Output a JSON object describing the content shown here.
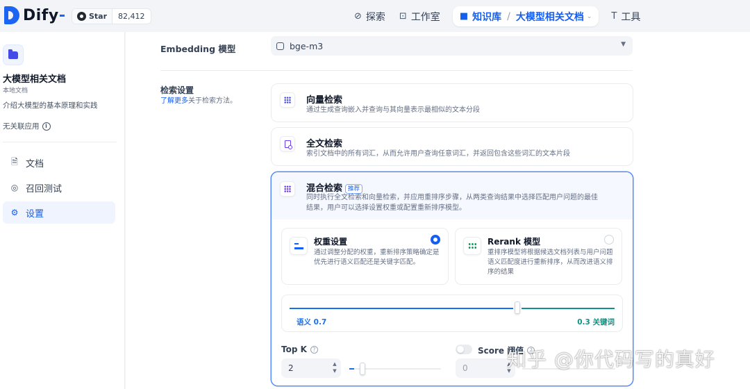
{
  "app": {
    "name": "Dify",
    "github_star_label": "Star",
    "github_star_count": "82,412"
  },
  "nav": {
    "explore": "探索",
    "studio": "工作室",
    "knowledge": "知识库",
    "separator": "/",
    "current_dataset": "大模型相关文档",
    "tools": "工具"
  },
  "sidebar": {
    "dataset_name": "大模型相关文档",
    "dataset_type": "本地文档",
    "dataset_desc": "介绍大模型的基本原理和实践",
    "linked_apps": "无关联应用",
    "items": [
      {
        "label": "文档",
        "icon": "document-icon"
      },
      {
        "label": "召回测试",
        "icon": "target-icon"
      },
      {
        "label": "设置",
        "icon": "gear-icon",
        "active": true
      }
    ]
  },
  "settings": {
    "embedding_label": "Embedding 模型",
    "embedding_value": "bge-m3",
    "retrieval_label": "检索设置",
    "retrieval_help_link": "了解更多",
    "retrieval_help_text": "关于检索方法。",
    "methods": [
      {
        "title": "向量检索",
        "desc": "通过生成查询嵌入并查询与其向量表示最相似的文本分段"
      },
      {
        "title": "全文检索",
        "desc": "索引文档中的所有词汇，从而允许用户查询任意词汇，并返回包含这些词汇的文本片段"
      },
      {
        "title": "混合检索",
        "badge": "推荐",
        "desc_line1": "同时执行全文检索和向量检索，并应用重排序步骤，从两类查询结果中选择匹配用户问题的最佳",
        "desc_line2": "结果，用户可以选择设置权重或配置重新排序模型。",
        "selected": true
      }
    ],
    "hybrid": {
      "weight_title": "权重设置",
      "weight_desc": "通过调整分配的权重，重新排序策略确定是优先进行语义匹配还是关键字匹配。",
      "weight_selected": true,
      "rerank_title": "Rerank 模型",
      "rerank_desc": "重排序模型将根据候选文档列表与用户问题语义匹配度进行重新排序，从而改进语义排序的结果",
      "rerank_selected": false,
      "semantic_label": "语义 0.7",
      "keyword_label": "0.3 关键词",
      "semantic_weight": 0.7
    },
    "top_k_label": "Top K",
    "top_k_value": "2",
    "top_k_fraction": 0.05,
    "score_label": "Score 阈值",
    "score_enabled": false,
    "score_value": "0"
  },
  "watermark": "知乎 @你代码写的真好",
  "colors": {
    "accent": "#155eef",
    "keyword": "#0e9384",
    "semantic": "#1570ef"
  }
}
